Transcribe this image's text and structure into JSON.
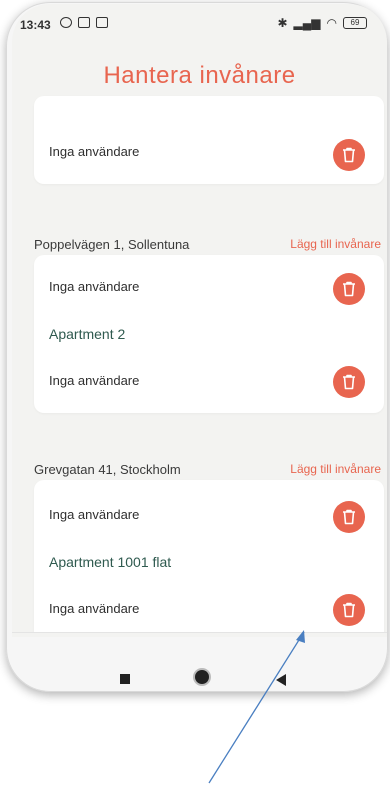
{
  "status_bar": {
    "time": "13:43",
    "battery": "69"
  },
  "header": {
    "title": "Hantera invånare"
  },
  "top_card": {
    "row_text": "Inga användare"
  },
  "houses": [
    {
      "address": "Poppelvägen 1, Sollentuna",
      "add_label": "Lägg till invånare",
      "rows": [
        {
          "text": "Inga användare"
        },
        {
          "apartment": "Apartment 2"
        },
        {
          "text": "Inga användare"
        }
      ]
    },
    {
      "address": "Grevgatan 41, Stockholm",
      "add_label": "Lägg till invånare",
      "rows": [
        {
          "text": "Inga användare"
        },
        {
          "apartment": "Apartment 1001 flat"
        },
        {
          "text": "Inga användare"
        }
      ]
    }
  ],
  "bottom_nav": {
    "items": [
      {
        "icon": "home-icon",
        "active": false
      },
      {
        "icon": "users-icon",
        "active": true
      },
      {
        "icon": "group-icon",
        "active": false
      },
      {
        "icon": "bell-icon",
        "active": false
      }
    ]
  },
  "colors": {
    "accent": "#e8654f",
    "background": "#f3f3f1",
    "card": "#ffffff",
    "apartment_text": "#2f5a4f"
  }
}
